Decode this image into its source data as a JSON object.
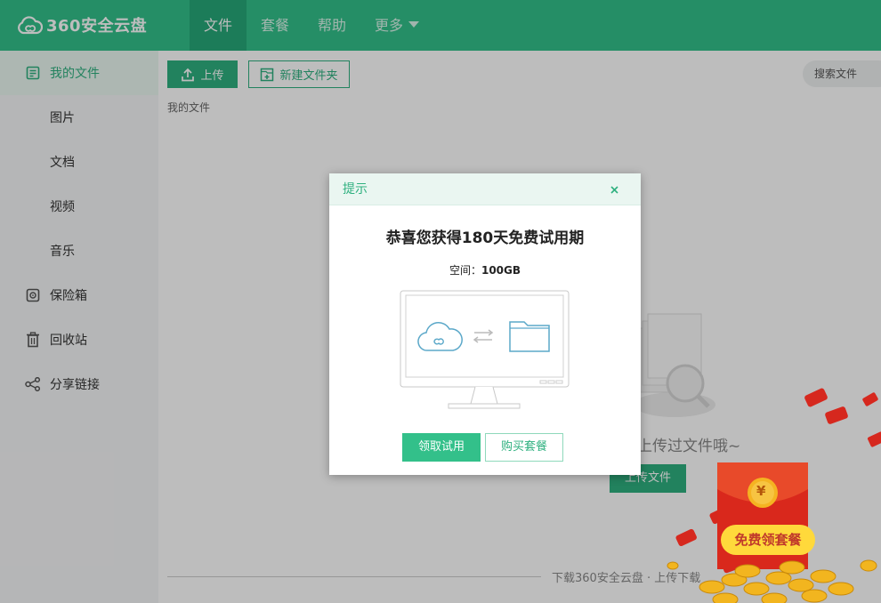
{
  "app": {
    "logo_text": "360安全云盘"
  },
  "nav": {
    "items": [
      {
        "label": "文件"
      },
      {
        "label": "套餐"
      },
      {
        "label": "帮助"
      },
      {
        "label": "更多"
      }
    ]
  },
  "sidebar": {
    "items": [
      {
        "label": "我的文件",
        "icon": "file-list-icon"
      },
      {
        "label": "图片"
      },
      {
        "label": "文档"
      },
      {
        "label": "视频"
      },
      {
        "label": "音乐"
      },
      {
        "label": "保险箱",
        "icon": "safe-icon"
      },
      {
        "label": "回收站",
        "icon": "trash-icon"
      },
      {
        "label": "分享链接",
        "icon": "share-icon"
      }
    ]
  },
  "toolbar": {
    "upload_label": "上传",
    "new_folder_label": "新建文件夹",
    "search_placeholder": "搜索文件"
  },
  "breadcrumb": "我的文件",
  "empty_state": {
    "message": "上传过文件哦~",
    "upload_button": "上传文件"
  },
  "footer": {
    "text": "下载360安全云盘 · 上传下载"
  },
  "promo": {
    "label": "免费领套餐",
    "currency_symbol": "¥"
  },
  "dialog": {
    "title": "提示",
    "heading": "恭喜您获得180天免费试用期",
    "space_label": "空间：",
    "space_value": "100GB",
    "primary_button": "领取试用",
    "secondary_button": "购买套餐"
  },
  "colors": {
    "brand": "#33c08a",
    "brand_dark": "#27a878",
    "sidebar_bg": "#f5f6f7"
  }
}
